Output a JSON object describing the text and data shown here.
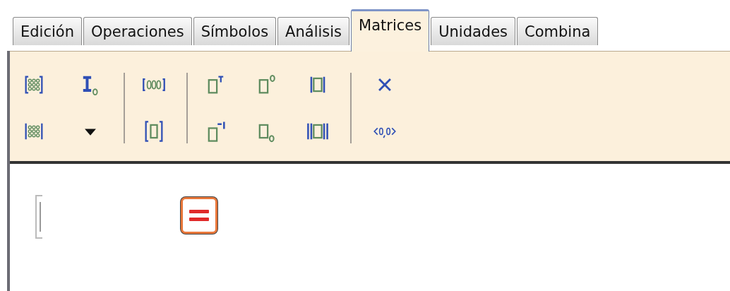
{
  "tabs": [
    {
      "label": "Edición",
      "selected": false
    },
    {
      "label": "Operaciones",
      "selected": false
    },
    {
      "label": "Símbolos",
      "selected": false
    },
    {
      "label": "Análisis",
      "selected": false
    },
    {
      "label": "Matrices",
      "selected": true
    },
    {
      "label": "Unidades",
      "selected": false
    },
    {
      "label": "Combina",
      "selected": false
    }
  ],
  "toolbar": {
    "groups": [
      {
        "columns": [
          [
            {
              "kind": "matrix"
            },
            {
              "kind": "determinant-matrix"
            }
          ],
          [
            {
              "kind": "identity"
            },
            {
              "kind": "dropdown"
            }
          ]
        ]
      },
      {
        "columns": [
          [
            {
              "kind": "row-vector"
            },
            {
              "kind": "single"
            }
          ]
        ]
      },
      {
        "columns": [
          [
            {
              "kind": "transpose"
            },
            {
              "kind": "inverse"
            }
          ],
          [
            {
              "kind": "conjugate"
            },
            {
              "kind": "subscript"
            }
          ],
          [
            {
              "kind": "abs"
            },
            {
              "kind": "norm"
            }
          ]
        ]
      },
      {
        "columns": [
          [
            {
              "kind": "cross"
            },
            {
              "kind": "vector"
            }
          ]
        ]
      }
    ]
  },
  "worksheet": {
    "items": [
      {
        "kind": "input"
      },
      {
        "kind": "equals"
      }
    ]
  }
}
